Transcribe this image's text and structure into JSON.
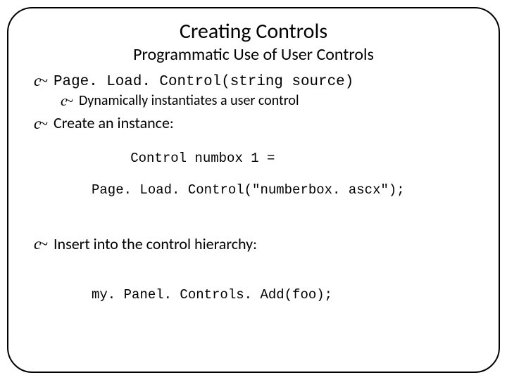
{
  "title": "Creating Controls",
  "subtitle": "Programmatic Use of User Controls",
  "bullets": {
    "b1": "Page. Load. Control(string source)",
    "b1a": "Dynamically instantiates a user control",
    "b2": "Create an instance:",
    "code1_line1": "Control numbox 1 =",
    "code1_line2": "Page. Load. Control(\"numberbox. ascx\");",
    "b3": "Insert into the control hierarchy:",
    "code2": "my. Panel. Controls. Add(foo);"
  },
  "bullet_glyph": "c~"
}
